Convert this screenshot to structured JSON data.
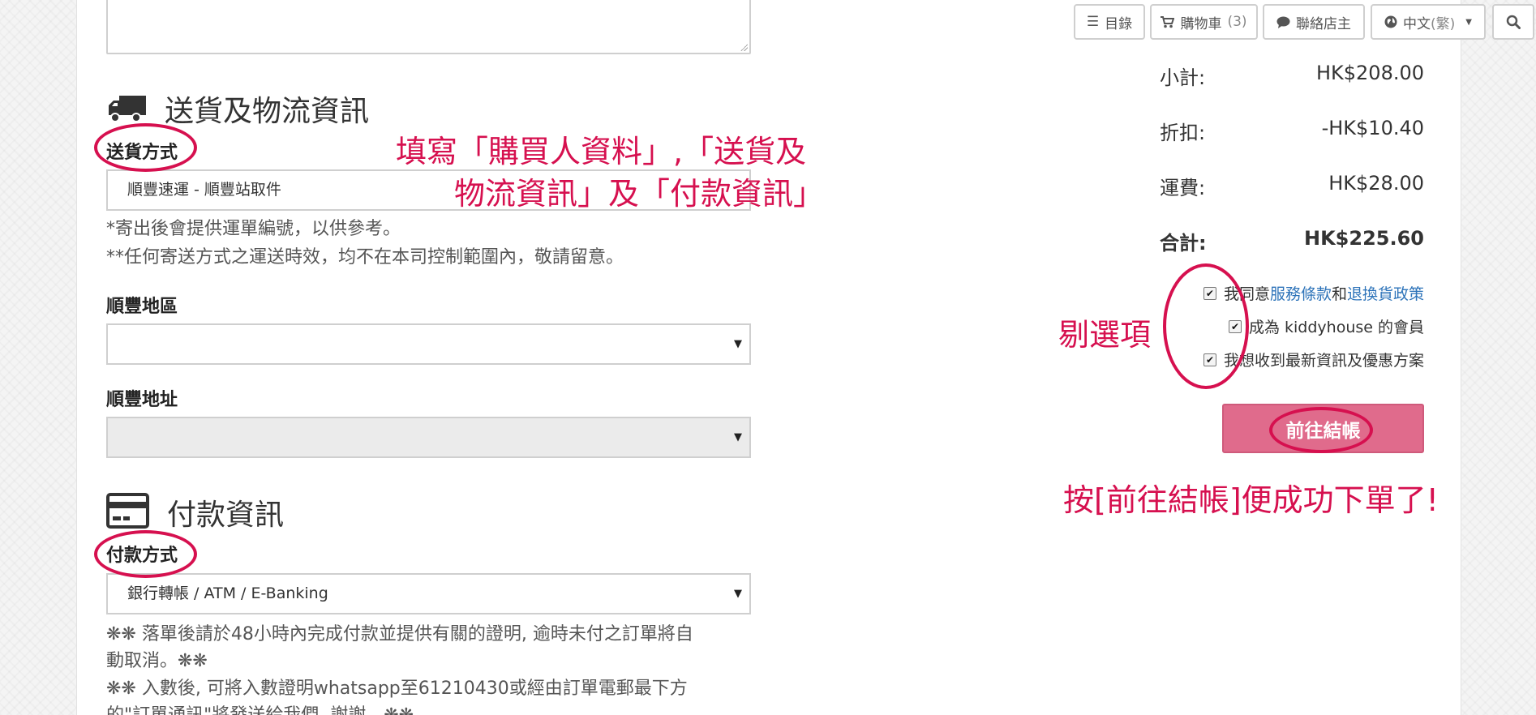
{
  "shipping": {
    "title": "送貨及物流資訊",
    "method_label": "送貨方式",
    "method_value": "順豐速運 - 順豐站取件",
    "note1": "*寄出後會提供運單編號，以供參考。",
    "note2": "**任何寄送方式之運送時效，均不在本司控制範圍內，敬請留意。",
    "region_label": "順豐地區",
    "region_value": "",
    "address_label": "順豐地址",
    "address_value": ""
  },
  "payment": {
    "title": "付款資訊",
    "method_label": "付款方式",
    "method_value": "銀行轉帳 / ATM / E-Banking",
    "note_line1": "❋❋ 落單後請於48小時內完成付款並提供有關的證明, 逾時未付之訂單將自",
    "note_line2": "動取消。❋❋",
    "note_line3": "❋❋ 入數後, 可將入數證明whatsapp至61210430或經由訂單電郵最下方",
    "note_line4": "的\"訂單通訊\"將發送給我們, 謝謝。❋❋"
  },
  "toolbar": {
    "menu": "目錄",
    "cart": "購物車",
    "cart_count": "(3)",
    "contact": "聯絡店主",
    "language": "中文",
    "language_variant": "(繁)"
  },
  "summary": {
    "subtotal_label": "小計:",
    "subtotal_value": "HK$208.00",
    "discount_label": "折扣:",
    "discount_value": "-HK$10.40",
    "shipping_label": "運費:",
    "shipping_value": "HK$28.00",
    "total_label": "合計:",
    "total_value": "HK$225.60"
  },
  "agreements": {
    "terms_prefix": "我同意",
    "terms_link": "服務條款",
    "terms_and": "和",
    "return_link": "退換貨政策",
    "member": "成為 kiddyhouse 的會員",
    "newsletter": "我想收到最新資訊及優惠方案"
  },
  "checkout_button": "前往結帳",
  "annotations": {
    "fill_line1": "填寫「購買人資料」,「送貨及",
    "fill_line2": "物流資訊」及「付款資訊」",
    "tick": "剔選項",
    "checkout_tip": "按[前往結帳]便成功下單了!"
  },
  "colors": {
    "annotation": "#d6104f",
    "checkout": "#e06b8c",
    "link": "#2d73b9"
  }
}
